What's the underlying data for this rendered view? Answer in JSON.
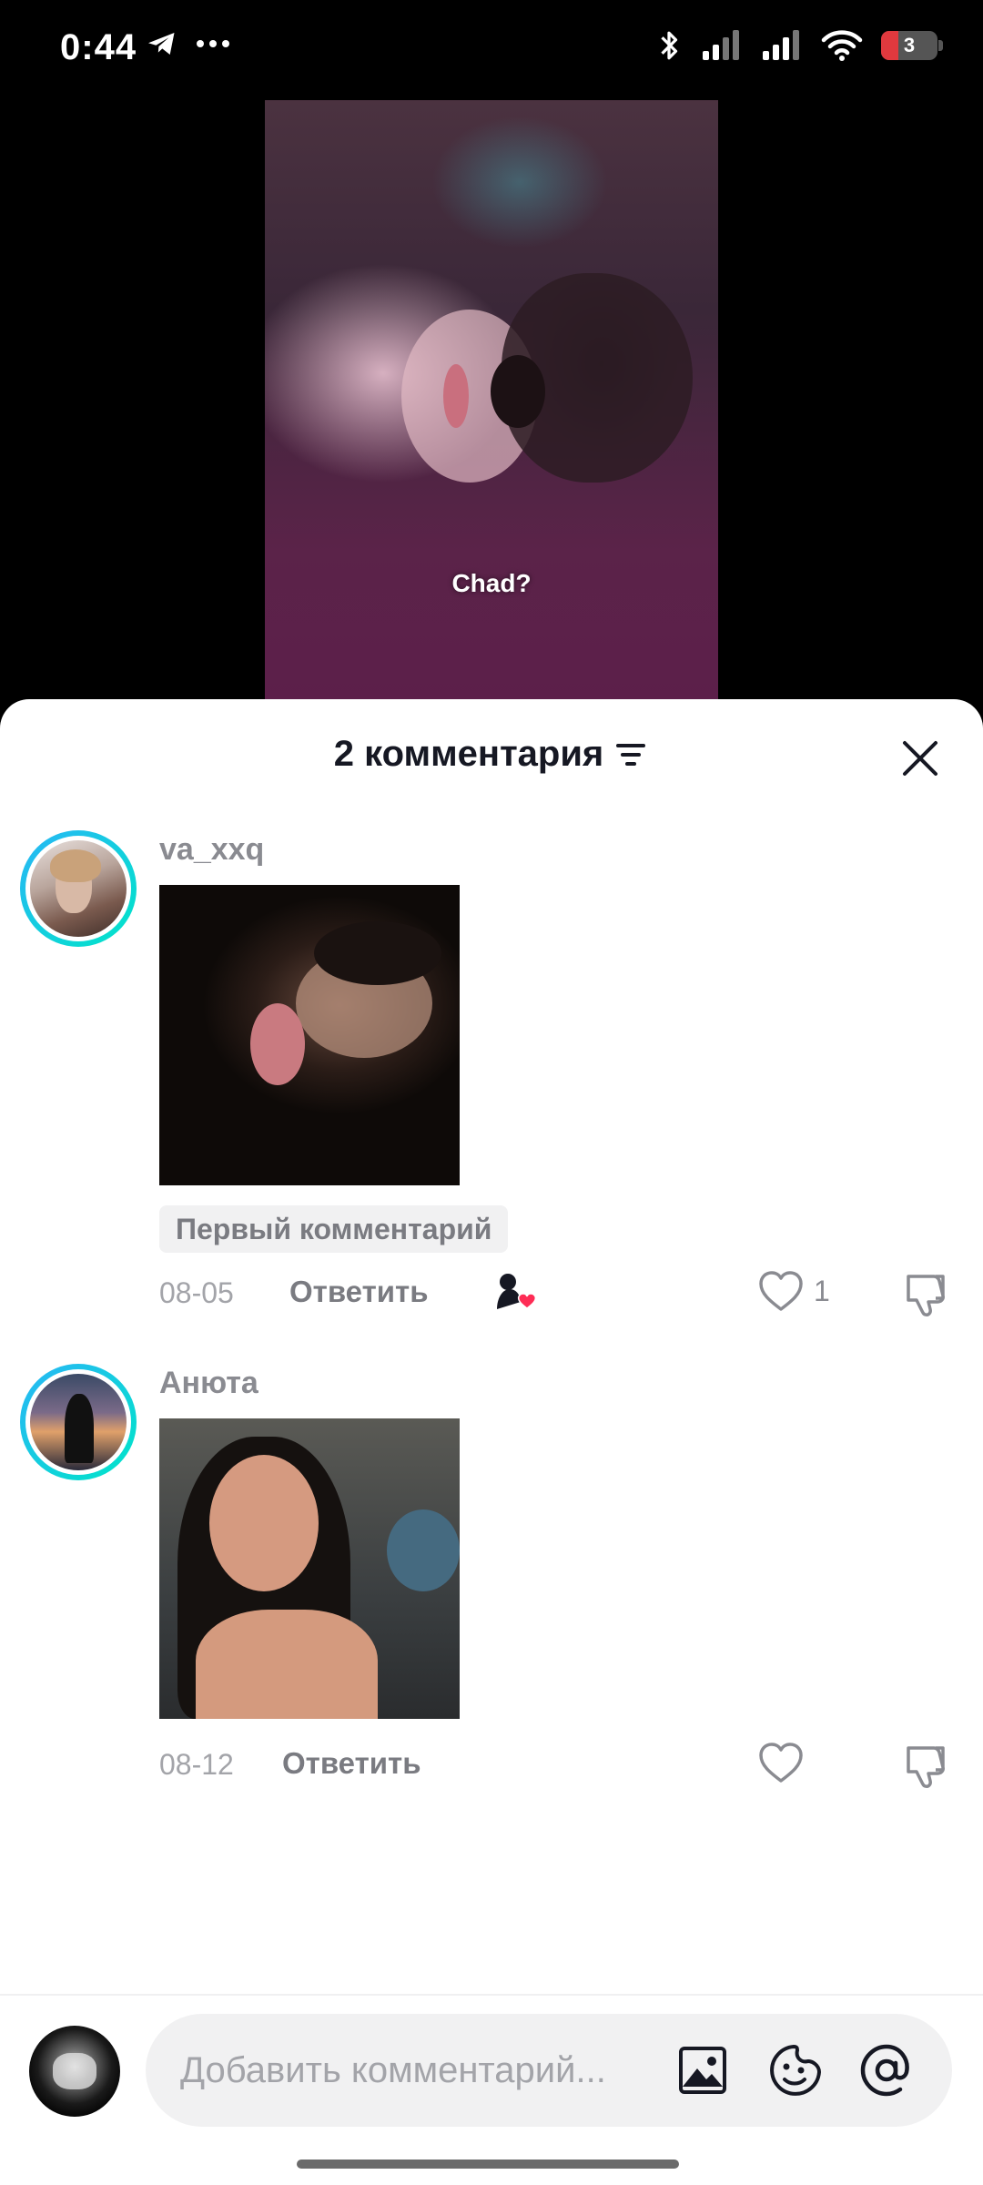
{
  "status_bar": {
    "time": "0:44",
    "battery_level": "3",
    "icons": [
      "telegram-icon",
      "more-dots-icon",
      "bluetooth-icon",
      "signal-icon",
      "signal-icon",
      "wifi-icon",
      "battery-icon"
    ]
  },
  "video": {
    "caption": "Chad?"
  },
  "comments_sheet": {
    "title": "2 комментария",
    "comments": [
      {
        "username": "va_xxq",
        "badge": "Первый комментарий",
        "date": "08-05",
        "reply_label": "Ответить",
        "like_count": "1",
        "creator_liked": true
      },
      {
        "username": "Анюта",
        "date": "08-12",
        "reply_label": "Ответить",
        "like_count": "",
        "creator_liked": false
      }
    ]
  },
  "composer": {
    "placeholder": "Добавить комментарий..."
  },
  "colors": {
    "avatar_ring_start": "#29b6f6",
    "avatar_ring_end": "#00e5c8",
    "like_heart": "#fe2c55"
  }
}
